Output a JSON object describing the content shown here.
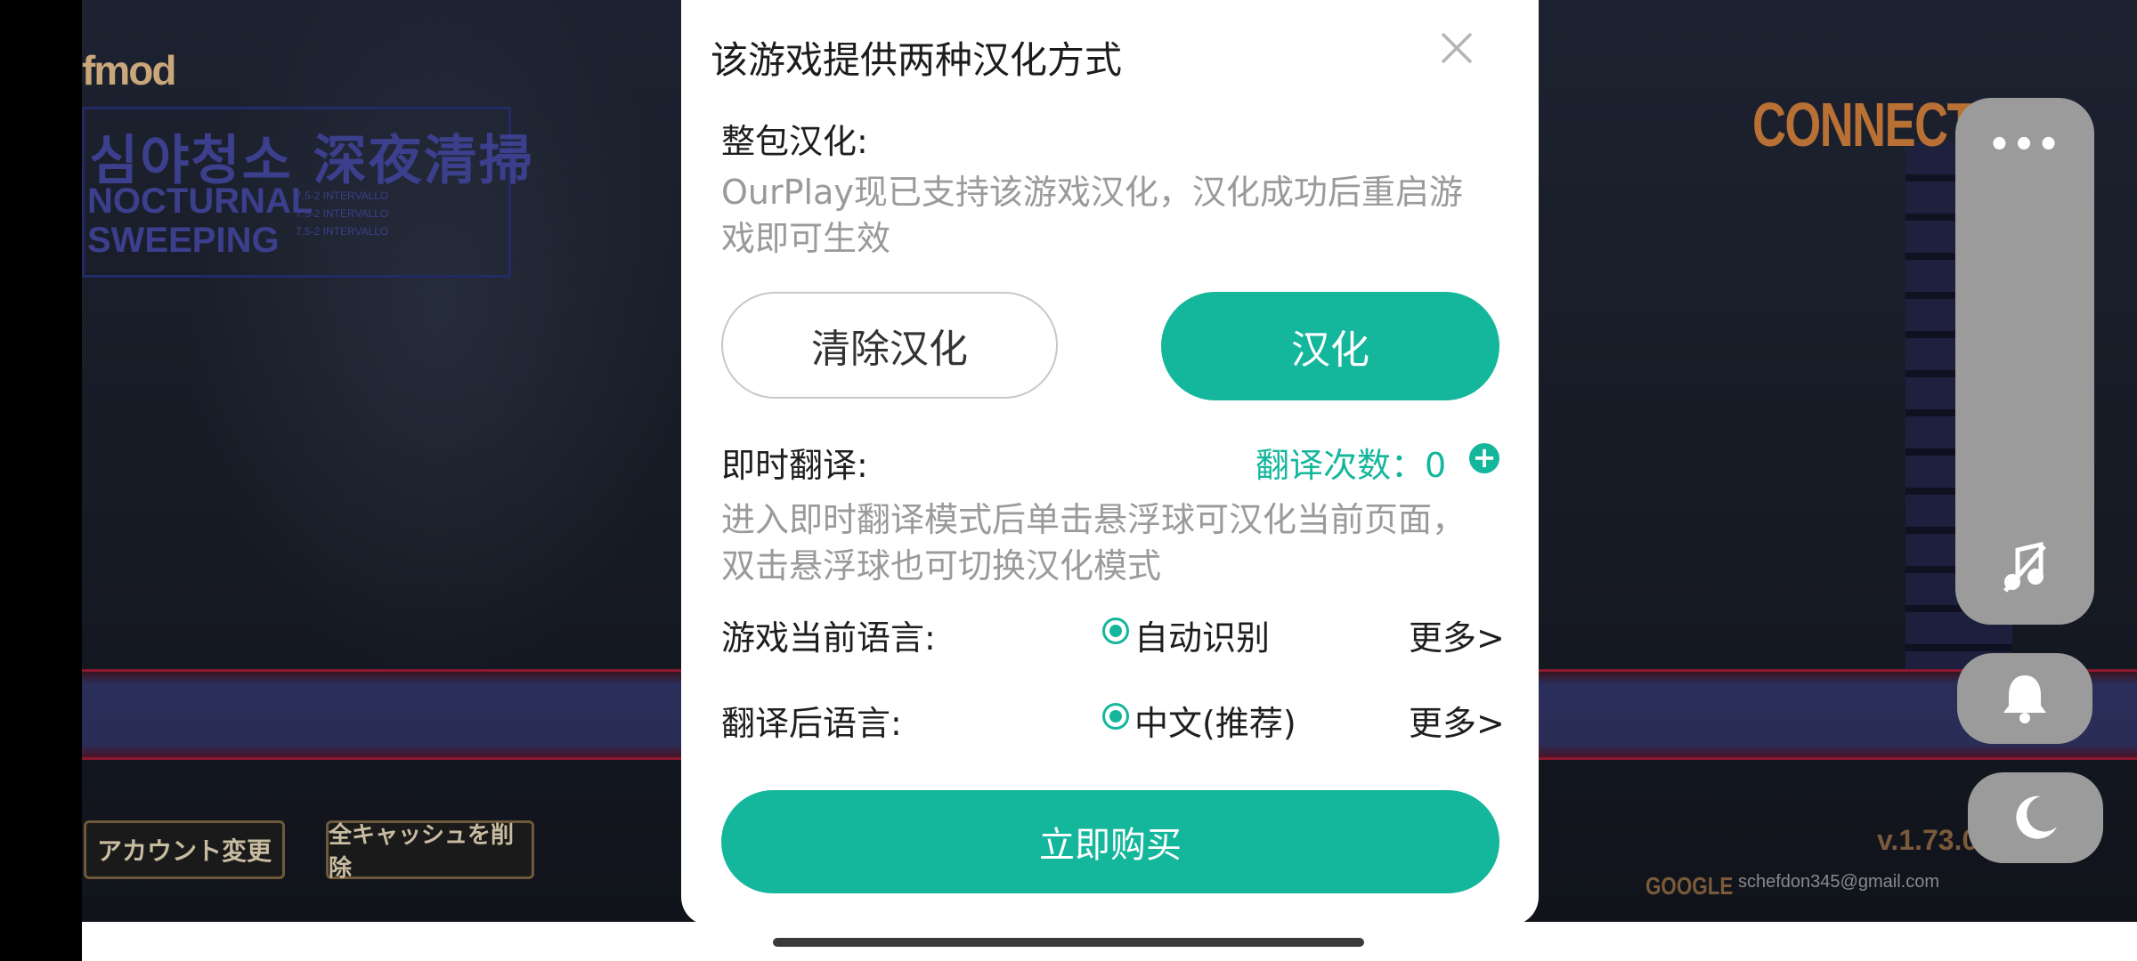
{
  "game": {
    "logo": "fmod",
    "title_kr": "심야청소 深夜清掃",
    "title_en": "NOCTURNAL SWEEPING",
    "interval_lines": [
      "7.5-2 INTERVALLO",
      "7.5-2 INTERVALLO",
      "7.5-2 INTERVALLO"
    ],
    "connecting": "CONNECTING",
    "version": "v.1.73.0",
    "login_provider": "GOOGLE",
    "email": "schefdon345@gmail.com",
    "account_change_btn": "アカウント変更",
    "clear_cache_btn": "全キャッシュを削除"
  },
  "dialog": {
    "title": "该游戏提供两种汉化方式",
    "full_pack": {
      "label": "整包汉化:",
      "desc": "OurPlay现已支持该游戏汉化，汉化成功后重启游戏即可生效",
      "clear_btn": "清除汉化",
      "localize_btn": "汉化"
    },
    "instant": {
      "label": "即时翻译:",
      "count_label": "翻译次数：",
      "count_value": "0",
      "desc": "进入即时翻译模式后单击悬浮球可汉化当前页面，双击悬浮球也可切换汉化模式"
    },
    "source_lang": {
      "label": "游戏当前语言:",
      "value": "自动识别",
      "more": "更多>"
    },
    "target_lang": {
      "label": "翻译后语言:",
      "value": "中文(推荐)",
      "more": "更多>"
    },
    "buy_btn": "立即购买"
  },
  "side_controls": {
    "more": "•••"
  },
  "colors": {
    "accent": "#14b69c",
    "side_panel": "#9b9b9b"
  }
}
